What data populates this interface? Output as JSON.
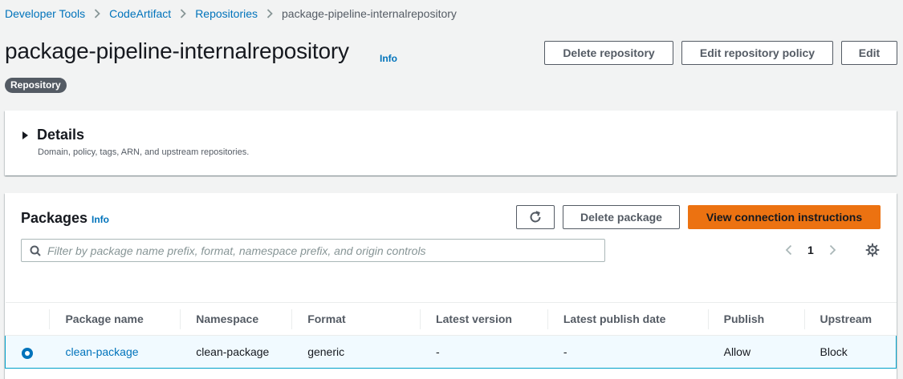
{
  "breadcrumb": {
    "items": [
      "Developer Tools",
      "CodeArtifact",
      "Repositories"
    ],
    "current": "package-pipeline-internalrepository"
  },
  "header": {
    "title": "package-pipeline-internalrepository",
    "info": "Info",
    "badge": "Repository",
    "buttons": {
      "delete_repository": "Delete repository",
      "edit_policy": "Edit repository policy",
      "edit": "Edit"
    }
  },
  "details": {
    "title": "Details",
    "description": "Domain, policy, tags, ARN, and upstream repositories."
  },
  "packages": {
    "title": "Packages",
    "info": "Info",
    "buttons": {
      "delete_package": "Delete package",
      "view_connection": "View connection instructions"
    },
    "filter_placeholder": "Filter by package name prefix, format, namespace prefix, and origin controls",
    "page": "1",
    "columns": [
      "Package name",
      "Namespace",
      "Format",
      "Latest version",
      "Latest publish date",
      "Publish",
      "Upstream"
    ],
    "rows": [
      {
        "name": "clean-package",
        "namespace": "clean-package",
        "format": "generic",
        "latest_version": "-",
        "latest_publish_date": "-",
        "publish": "Allow",
        "upstream": "Block"
      }
    ]
  },
  "icons": {
    "chevron_right": "chevron-right-icon",
    "refresh": "refresh-icon",
    "search": "search-icon",
    "settings": "gear-icon"
  },
  "colors": {
    "link": "#0073bb",
    "primary_button": "#ec7211",
    "selection_border": "#00a1c9",
    "badge": "#545b64"
  }
}
